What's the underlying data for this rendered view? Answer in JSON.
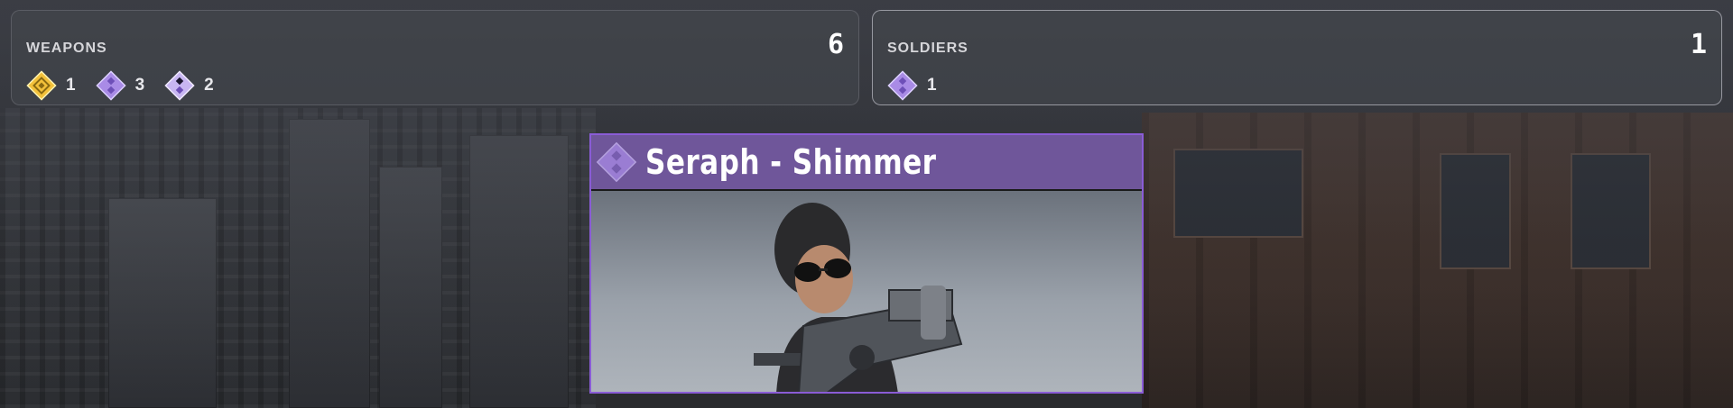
{
  "panels": {
    "weapons": {
      "title": "WEAPONS",
      "count": "6",
      "rarities": [
        {
          "icon": "gold-diamond-icon",
          "color": "#f3c13a",
          "value": "1"
        },
        {
          "icon": "purple-diamond-icon",
          "color": "#a98be6",
          "value": "3"
        },
        {
          "icon": "purple-dark-diamond-icon",
          "color": "#a98be6",
          "value": "2"
        }
      ]
    },
    "soldiers": {
      "title": "SOLDIERS",
      "count": "1",
      "rarities": [
        {
          "icon": "purple-diamond-icon",
          "color": "#a98be6",
          "value": "1"
        }
      ]
    }
  },
  "card": {
    "name": "Seraph - Shimmer",
    "rarity_icon": "purple-diamond-icon",
    "header_color": "#6f569a",
    "border_color": "#8a5cd6"
  }
}
